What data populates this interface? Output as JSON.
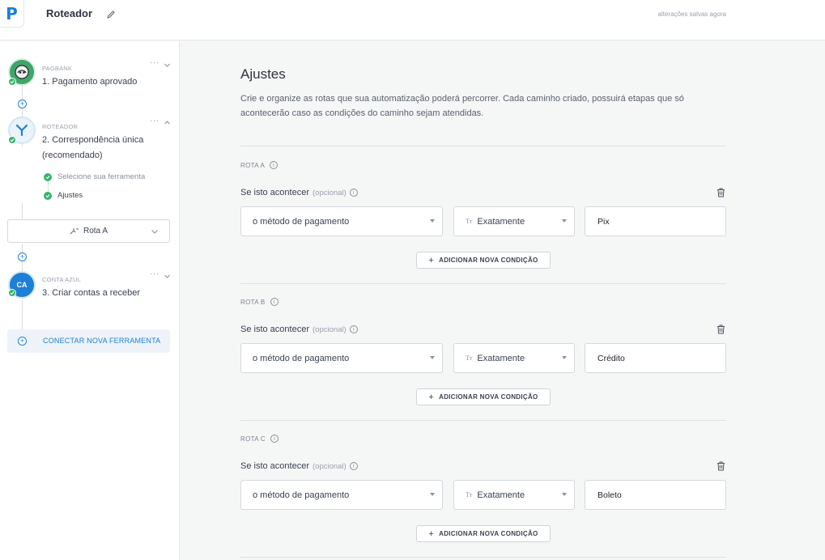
{
  "header": {
    "logo": "P",
    "title": "Roteador",
    "saved_status": "alterações salvas agora"
  },
  "sidebar": {
    "steps": [
      {
        "app": "PAGBANK",
        "title": "1. Pagamento aprovado",
        "menu": "···"
      },
      {
        "app": "ROTEADOR",
        "title_line1": "2. Correspondência única",
        "title_line2": "(recomendado)",
        "menu": "···",
        "substeps": [
          {
            "label": "Selecione sua ferramenta"
          },
          {
            "label": "Ajustes"
          }
        ]
      },
      {
        "app": "CONTA AZUL",
        "icon_text": "CA",
        "title": "3. Criar contas a receber",
        "menu": "···"
      }
    ],
    "route_selector": "Rota A",
    "connect_button": "CONECTAR NOVA FERRAMENTA"
  },
  "main": {
    "title": "Ajustes",
    "description": "Crie e organize as rotas que sua automatização poderá percorrer. Cada caminho criado, possuirá etapas que só acontecerão caso as condições do caminho sejam atendidas.",
    "routes": [
      {
        "label": "ROTA A",
        "condition_label": "Se isto acontecer",
        "optional": "(opcional)",
        "field": "o método de pagamento",
        "operator": "Exatamente",
        "operator_icon": "Tт",
        "value": "Pix",
        "add_button": "ADICIONAR NOVA CONDIÇÃO"
      },
      {
        "label": "ROTA B",
        "condition_label": "Se isto acontecer",
        "optional": "(opcional)",
        "field": "o método de pagamento",
        "operator": "Exatamente",
        "operator_icon": "Tт",
        "value": "Crédito",
        "add_button": "ADICIONAR NOVA CONDIÇÃO"
      },
      {
        "label": "ROTA C",
        "condition_label": "Se isto acontecer",
        "optional": "(opcional)",
        "field": "o método de pagamento",
        "operator": "Exatamente",
        "operator_icon": "Tт",
        "value": "Boleto",
        "add_button": "ADICIONAR NOVA CONDIÇÃO"
      }
    ]
  },
  "colors": {
    "accent": "#1e7fd6",
    "success": "#35b56a",
    "background": "#f5f6f6"
  }
}
